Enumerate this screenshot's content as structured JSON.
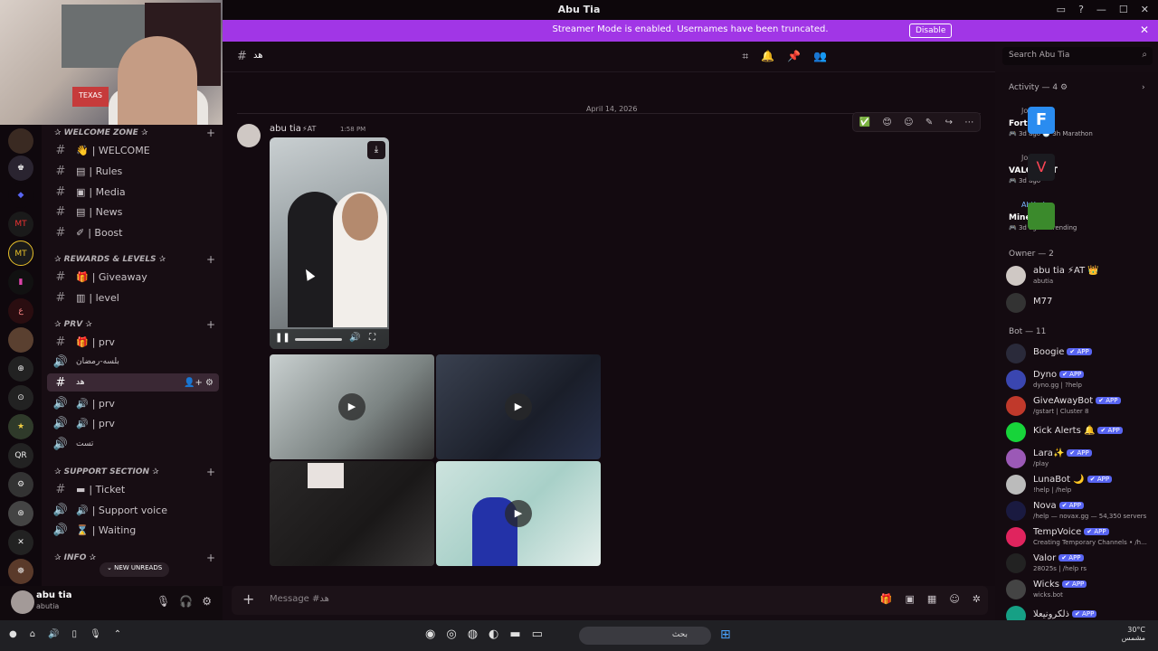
{
  "window": {
    "title": "Abu Tia"
  },
  "banner": {
    "text": "Streamer Mode is enabled. Usernames have been truncated.",
    "disable": "Disable"
  },
  "guilds": [
    "MT",
    "QR"
  ],
  "categories": [
    {
      "name": "✰ WELCOME ZONE ✰",
      "channels": [
        {
          "icon": "👋",
          "name": "| WELCOME"
        },
        {
          "icon": "▤",
          "name": "| Rules"
        },
        {
          "icon": "▣",
          "name": "| Media"
        },
        {
          "icon": "▤",
          "name": "| News"
        },
        {
          "icon": "✐",
          "name": "| Boost"
        }
      ]
    },
    {
      "name": "✰ REWARDS & LEVELS ✰",
      "channels": [
        {
          "icon": "🎁",
          "name": "| Giveaway"
        },
        {
          "icon": "▥",
          "name": "| level"
        }
      ]
    },
    {
      "name": "✰ PRV ✰",
      "channels": [
        {
          "icon": "🎁",
          "name": "| prv"
        },
        {
          "icon": "",
          "name": "بلسه-رمضان"
        },
        {
          "icon": "",
          "name": "هد"
        },
        {
          "icon": "🔊",
          "name": "| prv"
        },
        {
          "icon": "🔊",
          "name": "| prv"
        },
        {
          "icon": "",
          "name": "تست"
        }
      ]
    },
    {
      "name": "✰ SUPPORT SECTION ✰",
      "channels": [
        {
          "icon": "▬",
          "name": "| Ticket"
        },
        {
          "icon": "🔊",
          "name": "| Support voice"
        },
        {
          "icon": "⌛",
          "name": "| Waiting"
        }
      ]
    },
    {
      "name": "✰ INFO ✰",
      "channels": []
    }
  ],
  "unreads": "⌄ NEW UNREADS",
  "user": {
    "name": "abu tia",
    "handle": "abutia"
  },
  "chat": {
    "channel": "هد",
    "date": "April 14, 2026",
    "author": "abu tia",
    "tag": "⚡AT",
    "time": "1:58 PM",
    "composer_placeholder": "Message #هد"
  },
  "search": {
    "placeholder": "Search Abu Tia"
  },
  "activity": {
    "header": "Activity — 4 ⚙",
    "items": [
      {
        "user": "Jouri",
        "game": "Fortnite",
        "meta": "🎮 3d ago  🕒 3h Marathon",
        "color": "#2a8cf0"
      },
      {
        "user": "Jouri",
        "game": "VALORANT",
        "meta": "🎮 3d ago",
        "color": "#1b1b20"
      },
      {
        "user": "Abthal",
        "game": "Minecraft",
        "meta": "🎮 3d ago  ↗ Trending",
        "color": "#3b8a2c"
      }
    ]
  },
  "owner_header": "Owner — 2",
  "owners": [
    {
      "name": "abu tia ⚡AT 👑",
      "status": "abutia"
    },
    {
      "name": "M77",
      "status": ""
    }
  ],
  "bot_header": "Bot — 11",
  "bots": [
    {
      "name": "Boogie",
      "status": ""
    },
    {
      "name": "Dyno",
      "status": "dyno.gg | ?help"
    },
    {
      "name": "GiveAwayBot",
      "status": "/gstart | Cluster 8"
    },
    {
      "name": "Kick Alerts 🔔",
      "status": ""
    },
    {
      "name": "Lara✨",
      "status": "/play"
    },
    {
      "name": "LunaBot 🌙",
      "status": "!help | /help"
    },
    {
      "name": "Nova",
      "status": "/help — novax.gg — 54,350 servers"
    },
    {
      "name": "TempVoice",
      "status": "Creating Temporary Channels • /h..."
    },
    {
      "name": "Valor",
      "status": "28025s | /help rs"
    },
    {
      "name": "Wicks",
      "status": "wicks.bot"
    },
    {
      "name": "ذلكرونيعلا",
      "status": ""
    }
  ],
  "app_badge": "✔ APP",
  "taskbar": {
    "search": "بحث",
    "weather": "30°C",
    "weather_sub": "مشمس"
  }
}
